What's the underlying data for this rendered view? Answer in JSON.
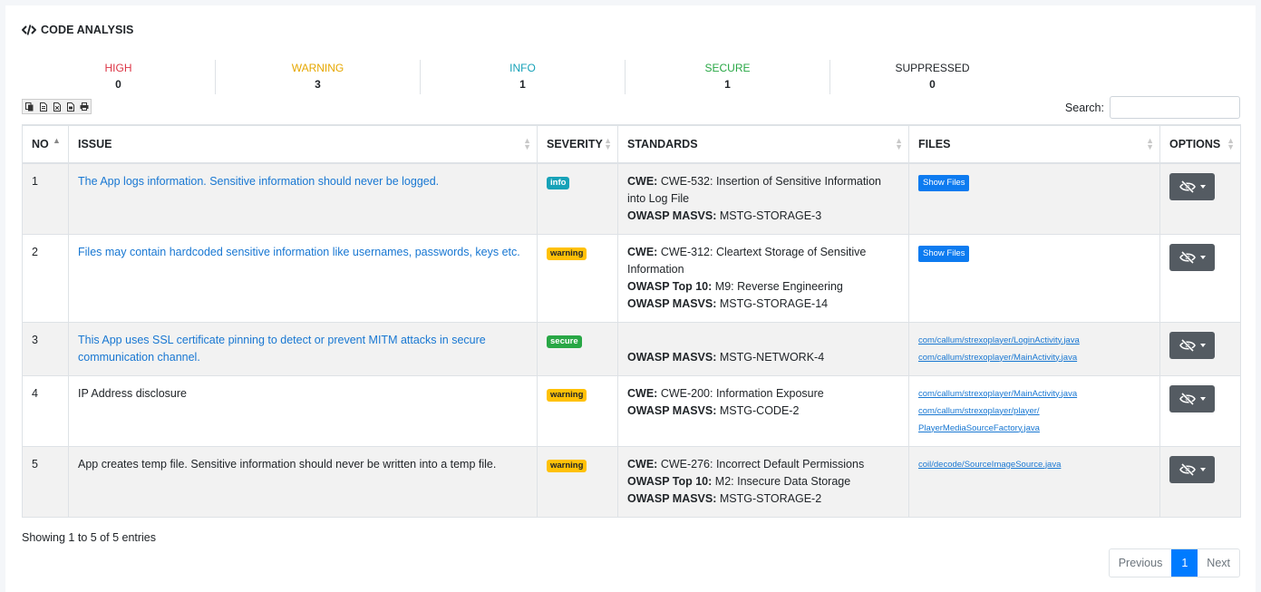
{
  "card": {
    "title": "CODE ANALYSIS",
    "icon": "code-icon"
  },
  "stats": [
    {
      "label": "HIGH",
      "value": "0",
      "color": "#dc3545"
    },
    {
      "label": "WARNING",
      "value": "3",
      "color": "#e6a700"
    },
    {
      "label": "INFO",
      "value": "1",
      "color": "#17a2b8"
    },
    {
      "label": "SECURE",
      "value": "1",
      "color": "#28a745"
    },
    {
      "label": "SUPPRESSED",
      "value": "0",
      "color": "#212529"
    }
  ],
  "toolbar": [
    "copy-icon",
    "csv-icon",
    "excel-icon",
    "pdf-icon",
    "print-icon"
  ],
  "search": {
    "label": "Search:",
    "value": ""
  },
  "table": {
    "headers": [
      "NO",
      "ISSUE",
      "SEVERITY",
      "STANDARDS",
      "FILES",
      "OPTIONS"
    ],
    "rows": [
      {
        "no": "1",
        "issue": "The App logs information. Sensitive information should never be logged.",
        "issue_link": true,
        "severity": "info",
        "standards": [
          {
            "key": "CWE:",
            "value": "CWE-532: Insertion of Sensitive Information into Log File"
          },
          {
            "key": "OWASP MASVS:",
            "value": "MSTG-STORAGE-3"
          }
        ],
        "files_button": "Show Files",
        "files": []
      },
      {
        "no": "2",
        "issue": "Files may contain hardcoded sensitive information like usernames, passwords, keys etc.",
        "issue_link": true,
        "severity": "warning",
        "standards": [
          {
            "key": "CWE:",
            "value": "CWE-312: Cleartext Storage of Sensitive Information"
          },
          {
            "key": "OWASP Top 10:",
            "value": "M9: Reverse Engineering"
          },
          {
            "key": "OWASP MASVS:",
            "value": "MSTG-STORAGE-14"
          }
        ],
        "files_button": "Show Files",
        "files": []
      },
      {
        "no": "3",
        "issue": "This App uses SSL certificate pinning to detect or prevent MITM attacks in secure communication channel.",
        "issue_link": true,
        "severity": "secure",
        "standards": [
          {
            "key": "",
            "value": ""
          },
          {
            "key": "OWASP MASVS:",
            "value": "MSTG-NETWORK-4"
          }
        ],
        "files_button": "",
        "files": [
          "com/callum/strexoplayer/LoginActivity.java",
          "com/callum/strexoplayer/MainActivity.java"
        ]
      },
      {
        "no": "4",
        "issue": "IP Address disclosure",
        "issue_link": false,
        "severity": "warning",
        "standards": [
          {
            "key": "CWE:",
            "value": "CWE-200: Information Exposure"
          },
          {
            "key": "OWASP MASVS:",
            "value": "MSTG-CODE-2"
          }
        ],
        "files_button": "",
        "files": [
          "com/callum/strexoplayer/MainActivity.java",
          "com/callum/strexoplayer/player/ PlayerMediaSourceFactory.java"
        ]
      },
      {
        "no": "5",
        "issue": "App creates temp file. Sensitive information should never be written into a temp file.",
        "issue_link": false,
        "severity": "warning",
        "standards": [
          {
            "key": "CWE:",
            "value": "CWE-276: Incorrect Default Permissions"
          },
          {
            "key": "OWASP Top 10:",
            "value": "M2: Insecure Data Storage"
          },
          {
            "key": "OWASP MASVS:",
            "value": "MSTG-STORAGE-2"
          }
        ],
        "files_button": "",
        "files": [
          "coil/decode/SourceImageSource.java"
        ]
      }
    ]
  },
  "footer": {
    "info": "Showing 1 to 5 of 5 entries"
  },
  "pager": {
    "previous": "Previous",
    "current": "1",
    "next": "Next"
  }
}
